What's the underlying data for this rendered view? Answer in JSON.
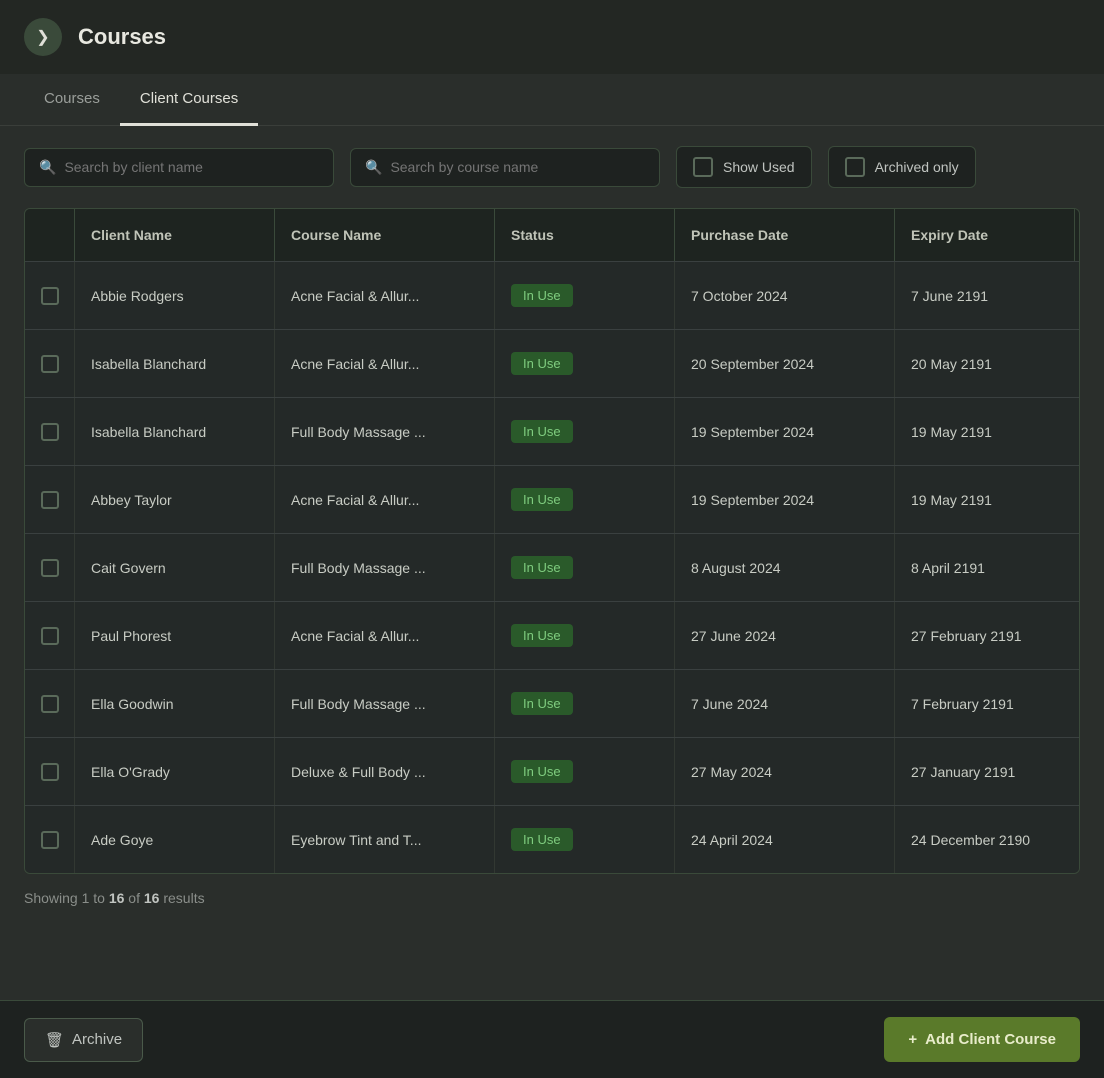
{
  "header": {
    "title": "Courses",
    "back_icon": "❯"
  },
  "tabs": [
    {
      "id": "courses",
      "label": "Courses",
      "active": false
    },
    {
      "id": "client-courses",
      "label": "Client Courses",
      "active": true
    }
  ],
  "controls": {
    "search_client_placeholder": "Search by client name",
    "search_course_placeholder": "Search by course name",
    "show_used_label": "Show Used",
    "archived_only_label": "Archived only"
  },
  "table": {
    "columns": [
      {
        "id": "select",
        "label": ""
      },
      {
        "id": "client-name",
        "label": "Client Name"
      },
      {
        "id": "course-name",
        "label": "Course Name"
      },
      {
        "id": "status",
        "label": "Status"
      },
      {
        "id": "purchase-date",
        "label": "Purchase Date"
      },
      {
        "id": "expiry-date",
        "label": "Expiry Date"
      }
    ],
    "rows": [
      {
        "client_name": "Abbie Rodgers",
        "course_name": "Acne Facial & Allur...",
        "status": "In Use",
        "purchase_date": "7 October 2024",
        "expiry_date": "7 June 2191"
      },
      {
        "client_name": "Isabella Blanchard",
        "course_name": "Acne Facial & Allur...",
        "status": "In Use",
        "purchase_date": "20 September 2024",
        "expiry_date": "20 May 2191"
      },
      {
        "client_name": "Isabella Blanchard",
        "course_name": "Full Body Massage ...",
        "status": "In Use",
        "purchase_date": "19 September 2024",
        "expiry_date": "19 May 2191"
      },
      {
        "client_name": "Abbey Taylor",
        "course_name": "Acne Facial & Allur...",
        "status": "In Use",
        "purchase_date": "19 September 2024",
        "expiry_date": "19 May 2191"
      },
      {
        "client_name": "Cait Govern",
        "course_name": "Full Body Massage ...",
        "status": "In Use",
        "purchase_date": "8 August 2024",
        "expiry_date": "8 April 2191"
      },
      {
        "client_name": "Paul Phorest",
        "course_name": "Acne Facial & Allur...",
        "status": "In Use",
        "purchase_date": "27 June 2024",
        "expiry_date": "27 February 2191"
      },
      {
        "client_name": "Ella Goodwin",
        "course_name": "Full Body Massage ...",
        "status": "In Use",
        "purchase_date": "7 June 2024",
        "expiry_date": "7 February 2191"
      },
      {
        "client_name": "Ella O'Grady",
        "course_name": "Deluxe & Full Body ...",
        "status": "In Use",
        "purchase_date": "27 May 2024",
        "expiry_date": "27 January 2191"
      },
      {
        "client_name": "Ade Goye",
        "course_name": "Eyebrow Tint and T...",
        "status": "In Use",
        "purchase_date": "24 April 2024",
        "expiry_date": "24 December 2190"
      }
    ]
  },
  "pagination": {
    "text": "Showing 1 to ",
    "bold1": "16",
    "text2": " of ",
    "bold2": "16",
    "text3": " results"
  },
  "footer": {
    "archive_label": "Archive",
    "add_label": "Add Client Course",
    "archive_icon": "🗑",
    "add_icon": "+"
  }
}
